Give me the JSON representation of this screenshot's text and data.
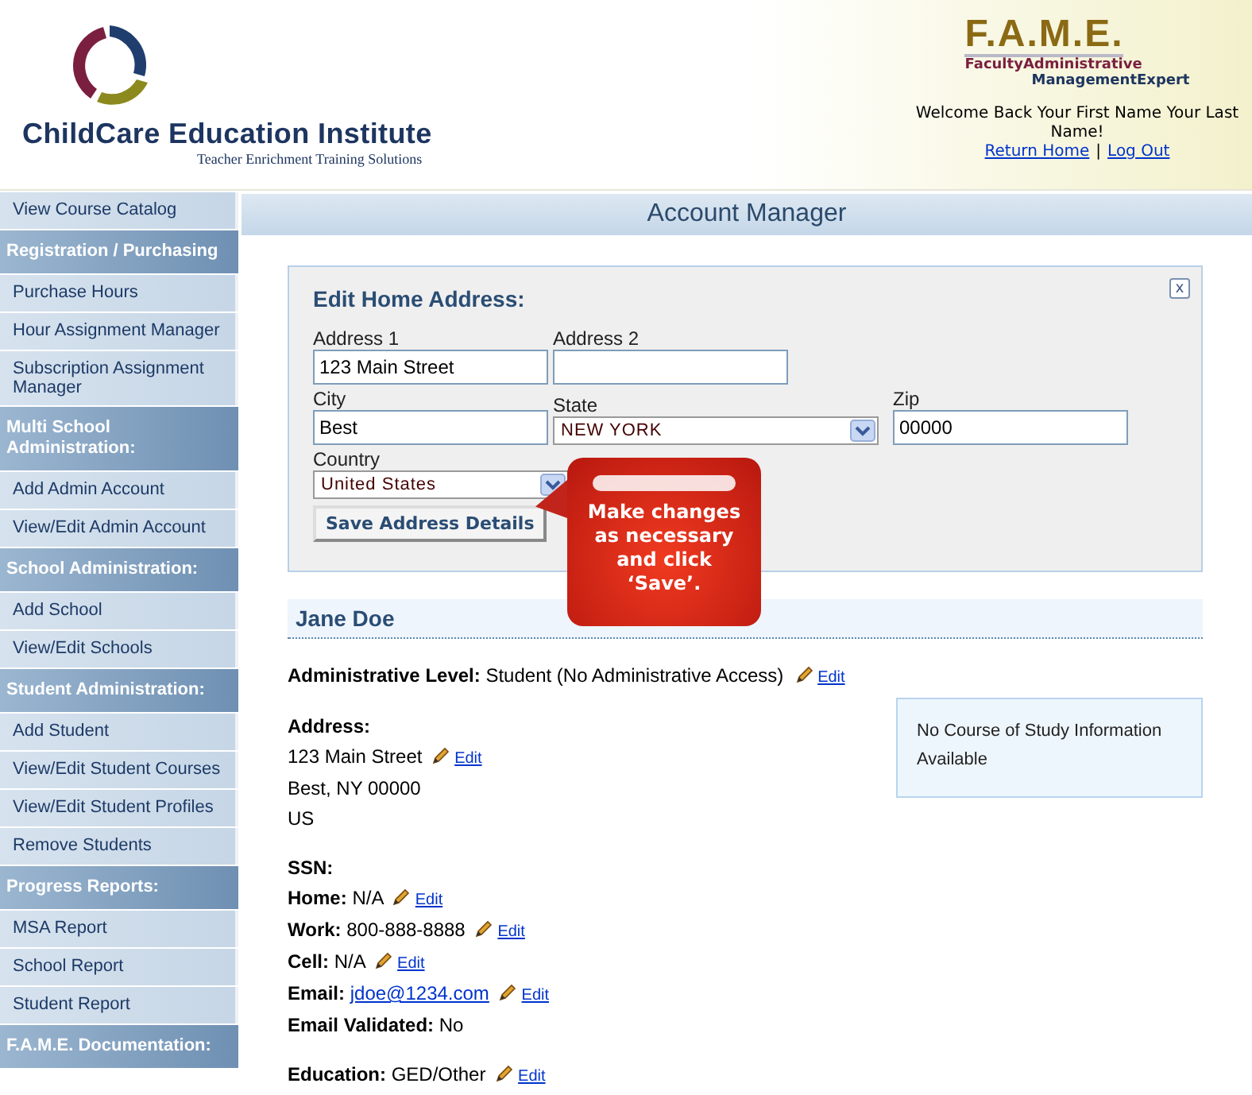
{
  "header": {
    "brand": "ChildCare Education Institute",
    "tagline": "Teacher Enrichment Training Solutions",
    "product": {
      "acronym": "F.A.M.E.",
      "line_1": "FacultyAdministrative",
      "line_2": "ManagementExpert"
    },
    "welcome": "Welcome Back Your First Name Your Last Name!",
    "links": [
      "Return Home",
      "Log Out"
    ],
    "separator": "|"
  },
  "sidebar": {
    "items": [
      {
        "kind": "link",
        "label": "View Course Catalog"
      },
      {
        "kind": "header",
        "label": "Registration / Purchasing"
      },
      {
        "kind": "link",
        "label": "Purchase Hours"
      },
      {
        "kind": "link",
        "label": "Hour Assignment Manager"
      },
      {
        "kind": "link",
        "label": "Subscription Assignment Manager"
      },
      {
        "kind": "header",
        "label": "Multi School Administration:"
      },
      {
        "kind": "link",
        "label": "Add Admin Account"
      },
      {
        "kind": "link",
        "label": "View/Edit Admin Account"
      },
      {
        "kind": "header",
        "label": "School Administration:"
      },
      {
        "kind": "link",
        "label": "Add School"
      },
      {
        "kind": "link",
        "label": "View/Edit Schools"
      },
      {
        "kind": "header",
        "label": "Student Administration:"
      },
      {
        "kind": "link",
        "label": "Add Student"
      },
      {
        "kind": "link",
        "label": "View/Edit Student Courses"
      },
      {
        "kind": "link",
        "label": "View/Edit Student Profiles"
      },
      {
        "kind": "link",
        "label": "Remove Students"
      },
      {
        "kind": "header",
        "label": "Progress Reports:"
      },
      {
        "kind": "link",
        "label": "MSA Report"
      },
      {
        "kind": "link",
        "label": "School Report"
      },
      {
        "kind": "link",
        "label": "Student Report"
      },
      {
        "kind": "header",
        "label": "F.A.M.E. Documentation:"
      }
    ]
  },
  "page_title": "Account Manager",
  "edit_panel": {
    "title": "Edit Home Address:",
    "close": "x",
    "fields": [
      {
        "kind": "text",
        "label": "Address 1",
        "value": "123 Main Street"
      },
      {
        "kind": "text",
        "label": "Address 2"
      },
      {
        "kind": "text",
        "label": "City",
        "value": "Best"
      },
      {
        "kind": "select",
        "label": "State",
        "value": "NEW YORK"
      },
      {
        "kind": "text",
        "label": "Zip",
        "value": "00000"
      },
      {
        "kind": "select",
        "label": "Country",
        "value": "United States"
      }
    ],
    "save_button": "Save Address Details"
  },
  "callout": "Make changes as necessary and click ‘Save’.",
  "profile": {
    "name": "Jane Doe",
    "level": {
      "label": "Administrative Level:",
      "value": "Student (No Administrative Access)",
      "edit": "Edit"
    },
    "sections": [
      {
        "lines": [
          {
            "label": "Address:"
          },
          {
            "value": "123 Main Street",
            "edit": "Edit"
          },
          {
            "value": "Best, NY 00000"
          },
          {
            "value": "US"
          }
        ]
      },
      {
        "lines": [
          {
            "label": "SSN:"
          },
          {
            "label": "Home:",
            "value": "N/A",
            "edit": "Edit"
          },
          {
            "label": "Work:",
            "value": "800-888-8888",
            "edit": "Edit"
          },
          {
            "label": "Cell:",
            "value": "N/A",
            "edit": "Edit"
          },
          {
            "label": "Email:",
            "link": "jdoe@1234.com",
            "edit": "Edit"
          },
          {
            "label": "Email Validated:",
            "value": "No"
          }
        ]
      },
      {
        "lines": [
          {
            "label": "Education:",
            "value": "GED/Other",
            "edit": "Edit"
          }
        ]
      }
    ],
    "course_info": "No Course of Study Information Available"
  }
}
